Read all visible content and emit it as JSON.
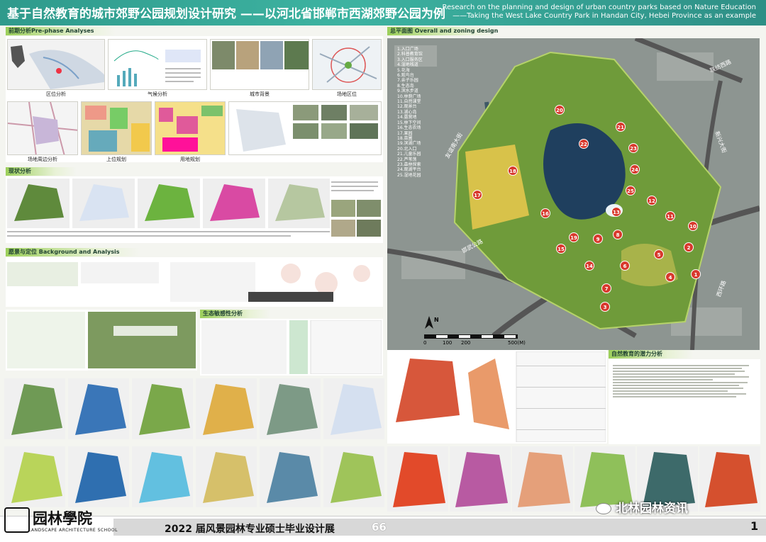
{
  "header": {
    "title_cn": "基于自然教育的城市郊野公园规划设计研究 ——以河北省邯郸市西湖郊野公园为例",
    "title_en_1": "Research on the planning and design of urban country parks based on Nature Education",
    "title_en_2": "——Taking the West Lake Country Park in Handan City, Hebei Province as an example"
  },
  "sections": {
    "pre_phase": "前期分析Pre-phase Analyses",
    "status": "现状分析",
    "background": "愿景与定位 Background and Analysis",
    "ecology": "生态敏感性分析",
    "master_plan": "总平面图 Overall and zoning design",
    "nature_edu": "自然教育的潜力分析"
  },
  "pre_captions": [
    "区位分析",
    "气候分析",
    "城市背景",
    "场地区位",
    "场地周边分析",
    "上位规划",
    "用地规划"
  ],
  "plan": {
    "roads": [
      "联纺西路",
      "新兴大街",
      "友谊南大街",
      "邯武公路",
      "西环路"
    ],
    "legend": [
      "1.入口广场",
      "2.科普教育馆",
      "3.入口服务区",
      "4.湿地栈道",
      "5.花海",
      "6.观鸟台",
      "7.亲子乐园",
      "8.生态岛",
      "9.滨水步道",
      "10.林荫广场",
      "11.自然课堂",
      "12.观景台",
      "13.湖心岛",
      "14.露营地",
      "15.林下空间",
      "16.生态农场",
      "17.果园",
      "18.苗圃",
      "19.滨湖广场",
      "20.北入口",
      "21.儿童乐园",
      "22.芦苇荡",
      "23.森林探索",
      "24.观湖平台",
      "25.湿地花园"
    ],
    "markers": [
      "1",
      "2",
      "3",
      "4",
      "5",
      "6",
      "7",
      "8",
      "9",
      "10",
      "11",
      "12",
      "13",
      "14",
      "15",
      "16",
      "17",
      "18",
      "19",
      "20",
      "21",
      "22",
      "23",
      "24",
      "25"
    ],
    "scale": [
      "0",
      "100",
      "200",
      "500(M)"
    ],
    "north": "N"
  },
  "footer": {
    "logo_cn": "园林學院",
    "logo_en": "LANDSCAPE ARCHITECTURE SCHOOL",
    "title": "2022 届风景园林专业硕士毕业设计展",
    "exhibit_no": "66",
    "page": "1",
    "wechat": "北林园林资讯"
  },
  "colors": {
    "header": "#3db3a1",
    "section_bar": "#9ccf5a",
    "marker": "#d8392d"
  }
}
